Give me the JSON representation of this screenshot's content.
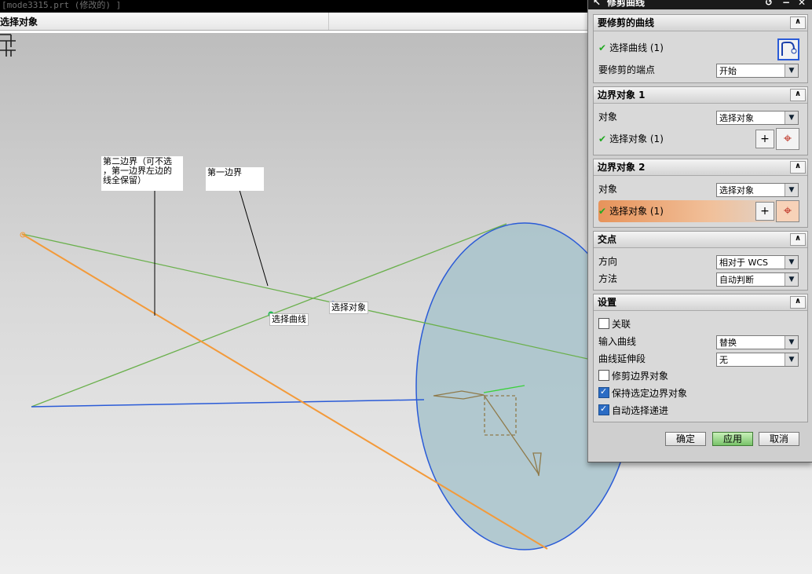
{
  "window": {
    "title": "[mode3315.prt (修改的) ]"
  },
  "cue": {
    "text": "选择对象"
  },
  "viewport": {
    "note_second": "第二边界（可不选\n，第一边界左边的\n线全保留）",
    "note_first": "第一边界",
    "tag_curve": "选择曲线",
    "tag_object": "选择对象"
  },
  "dialog": {
    "title": "修剪曲线",
    "groups": {
      "curve": {
        "header": "要修剪的曲线",
        "select_label": "选择曲线 (1)",
        "endpoint_label": "要修剪的端点",
        "endpoint_value": "开始"
      },
      "boundary1": {
        "header": "边界对象 1",
        "object_label": "对象",
        "object_value": "选择对象",
        "select_label": "选择对象 (1)"
      },
      "boundary2": {
        "header": "边界对象 2",
        "object_label": "对象",
        "object_value": "选择对象",
        "select_label": "选择对象 (1)"
      },
      "intersection": {
        "header": "交点",
        "direction_label": "方向",
        "direction_value": "相对于 WCS",
        "method_label": "方法",
        "method_value": "自动判断"
      },
      "settings": {
        "header": "设置",
        "associative_label": "关联",
        "associative_checked": false,
        "input_curve_label": "输入曲线",
        "input_curve_value": "替换",
        "extension_label": "曲线延伸段",
        "extension_value": "无",
        "trim_boundary_label": "修剪边界对象",
        "trim_boundary_checked": false,
        "keep_boundary_label": "保持选定边界对象",
        "keep_boundary_checked": true,
        "auto_advance_label": "自动选择递进",
        "auto_advance_checked": true
      }
    },
    "buttons": {
      "ok": "确定",
      "apply": "应用",
      "cancel": "取消"
    }
  },
  "colors": {
    "boundary_line": "#6ab04c",
    "trim_line": "#f39a3a",
    "base_line": "#2a5bd7",
    "disc_fill": "#a8c3cb",
    "highlight": "#e7935a"
  }
}
